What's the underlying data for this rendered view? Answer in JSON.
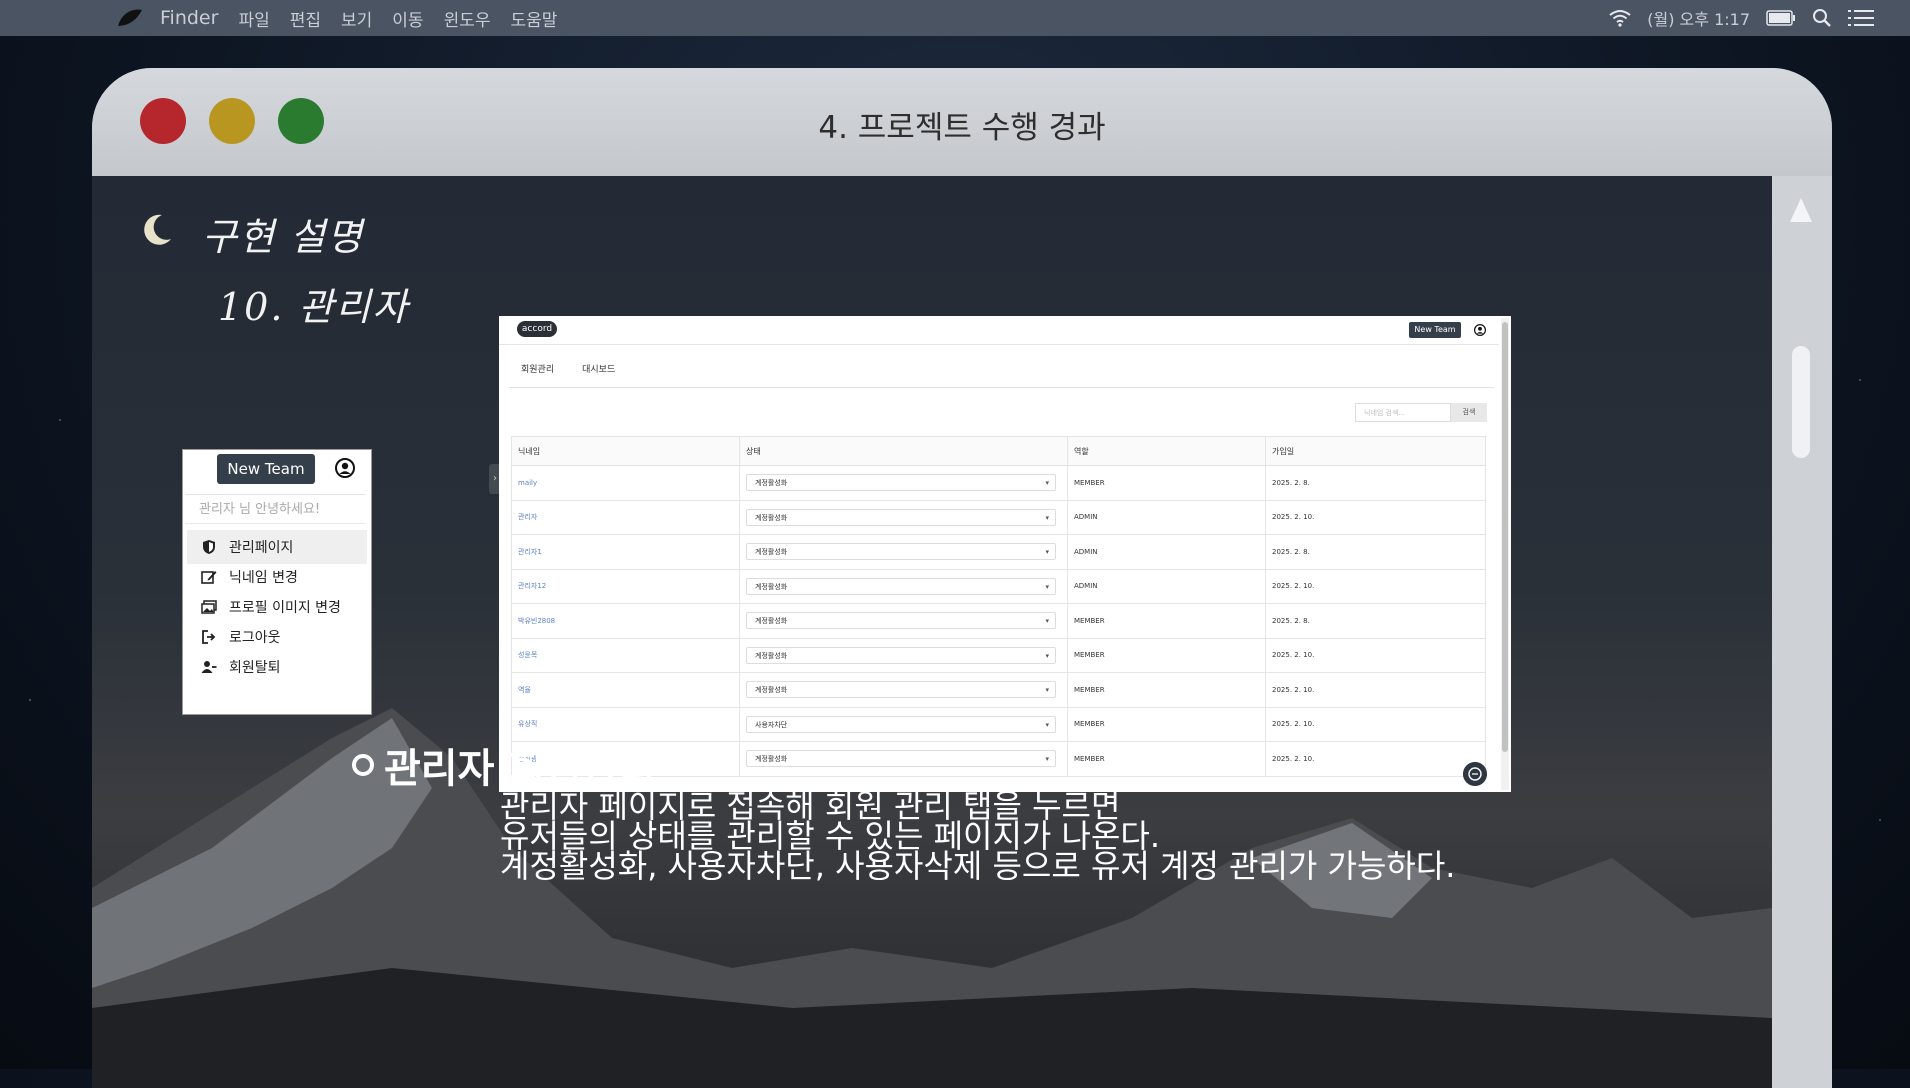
{
  "menubar": {
    "app_name": "Finder",
    "items": [
      "파일",
      "편집",
      "보기",
      "이동",
      "윈도우",
      "도움말"
    ],
    "clock": "(월) 오후 1:17"
  },
  "window": {
    "title": "4. 프로젝트 수행 경과",
    "colors": {
      "red": "#b5272d",
      "yellow": "#b89620",
      "green": "#2a7a2f"
    }
  },
  "handwriting": {
    "line1": "구현 설명",
    "line2": "10. 관리자"
  },
  "dropdown": {
    "new_team": "New Team",
    "greeting": "관리자 님 안녕하세요!",
    "items": [
      {
        "label": "관리페이지",
        "icon": "shield-icon"
      },
      {
        "label": "닉네임 변경",
        "icon": "edit-icon"
      },
      {
        "label": "프로필 이미지 변경",
        "icon": "images-icon"
      },
      {
        "label": "로그아웃",
        "icon": "logout-icon"
      },
      {
        "label": "회원탈퇴",
        "icon": "user-remove-icon"
      }
    ]
  },
  "app": {
    "logo": "accord",
    "new_team": "New Team",
    "tabs": [
      "회원관리",
      "대시보드"
    ],
    "search_placeholder": "닉네임 검색...",
    "search_button": "검색",
    "columns": [
      "닉네임",
      "상태",
      "역할",
      "가입일"
    ],
    "rows": [
      {
        "nick": "maily",
        "status": "계정활성화",
        "role": "MEMBER",
        "joined": "2025. 2. 8."
      },
      {
        "nick": "관리자",
        "status": "계정활성화",
        "role": "ADMIN",
        "joined": "2025. 2. 10."
      },
      {
        "nick": "관리자1",
        "status": "계정활성화",
        "role": "ADMIN",
        "joined": "2025. 2. 8."
      },
      {
        "nick": "관리자12",
        "status": "계정활성화",
        "role": "ADMIN",
        "joined": "2025. 2. 10."
      },
      {
        "nick": "박유빈2808",
        "status": "계정활성화",
        "role": "MEMBER",
        "joined": "2025. 2. 8."
      },
      {
        "nick": "성윤목",
        "status": "계정활성화",
        "role": "MEMBER",
        "joined": "2025. 2. 10."
      },
      {
        "nick": "역율",
        "status": "계정활성화",
        "role": "MEMBER",
        "joined": "2025. 2. 10."
      },
      {
        "nick": "유상직",
        "status": "사용자차단",
        "role": "MEMBER",
        "joined": "2025. 2. 10."
      },
      {
        "nick": "정석광",
        "status": "계정활성화",
        "role": "MEMBER",
        "joined": "2025. 2. 10."
      }
    ]
  },
  "section": {
    "title": "관리자 회원관리",
    "lines": [
      "관리자 페이지로 접속해 회원 관리 탭을 누르면",
      "유저들의 상태를 관리할 수 있는 페이지가 나온다.",
      "계정활성화, 사용자차단, 사용자삭제 등으로 유저 계정 관리가 가능하다."
    ]
  }
}
